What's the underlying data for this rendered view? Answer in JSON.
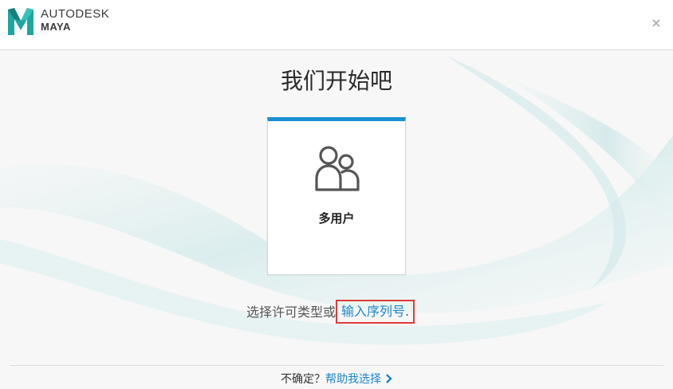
{
  "header": {
    "brand_top": "AUTODESK",
    "brand_bottom": "MAYA",
    "close_label": "×",
    "logo_icon": "maya-m-logo-icon"
  },
  "main": {
    "title": "我们开始吧",
    "card": {
      "label": "多用户",
      "icon": "multi-user-icon",
      "accent_color": "#1a8fd4"
    },
    "license_text": "选择许可类型或",
    "serial_link": "输入序列号",
    "serial_suffix": "."
  },
  "footer": {
    "question": "不确定？",
    "help_link": "帮助我选择",
    "chevron_icon": "chevron-right-icon"
  },
  "colors": {
    "link": "#1e86c8",
    "highlight_box": "#e03a3a",
    "logo_teal": "#1fa5a0"
  }
}
